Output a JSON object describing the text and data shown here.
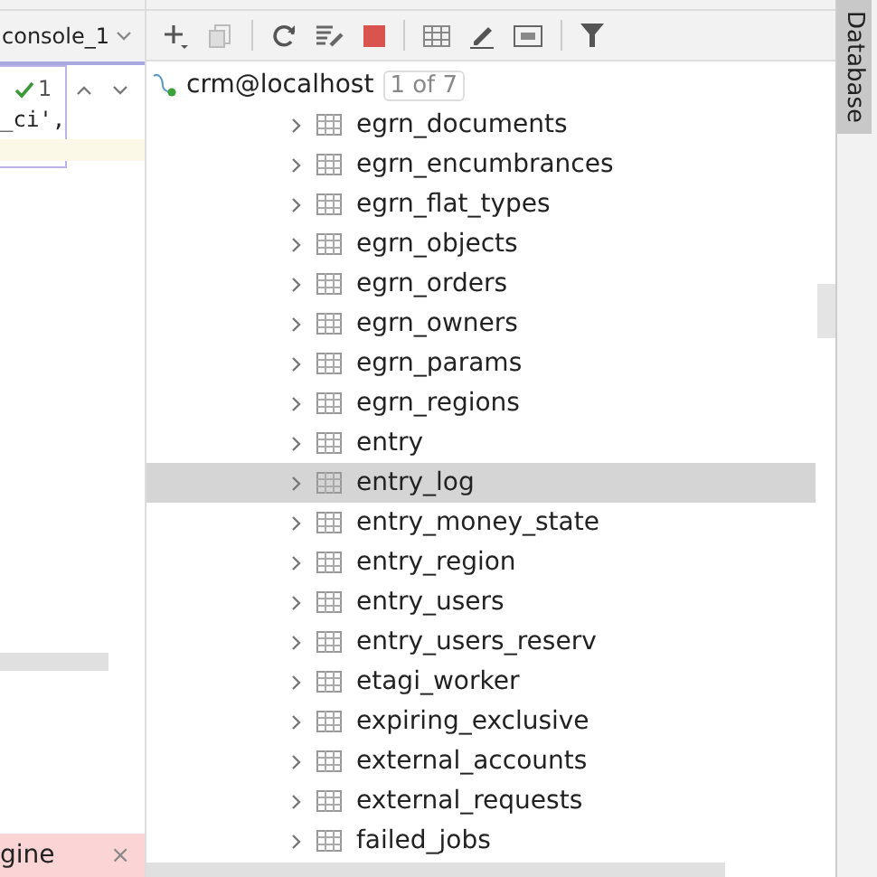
{
  "editor": {
    "tab": {
      "label": "console_1",
      "selected": true
    },
    "check_count": "1",
    "code_line": "_ci',",
    "bottom_tab": {
      "label": "gine",
      "close": "×"
    }
  },
  "tree": {
    "connection": "crm@localhost",
    "counter": "1 of 7",
    "items": [
      {
        "label": "egrn_documents",
        "selected": false
      },
      {
        "label": "egrn_encumbrances",
        "selected": false
      },
      {
        "label": "egrn_flat_types",
        "selected": false
      },
      {
        "label": "egrn_objects",
        "selected": false
      },
      {
        "label": "egrn_orders",
        "selected": false
      },
      {
        "label": "egrn_owners",
        "selected": false
      },
      {
        "label": "egrn_params",
        "selected": false
      },
      {
        "label": "egrn_regions",
        "selected": false
      },
      {
        "label": "entry",
        "selected": false
      },
      {
        "label": "entry_log",
        "selected": true
      },
      {
        "label": "entry_money_state",
        "selected": false
      },
      {
        "label": "entry_region",
        "selected": false
      },
      {
        "label": "entry_users",
        "selected": false
      },
      {
        "label": "entry_users_reserv",
        "selected": false
      },
      {
        "label": "etagi_worker",
        "selected": false
      },
      {
        "label": "expiring_exclusive",
        "selected": false
      },
      {
        "label": "external_accounts",
        "selected": false
      },
      {
        "label": "external_requests",
        "selected": false
      },
      {
        "label": "failed_jobs",
        "selected": false
      }
    ]
  },
  "side_tab": {
    "label": "Database"
  }
}
